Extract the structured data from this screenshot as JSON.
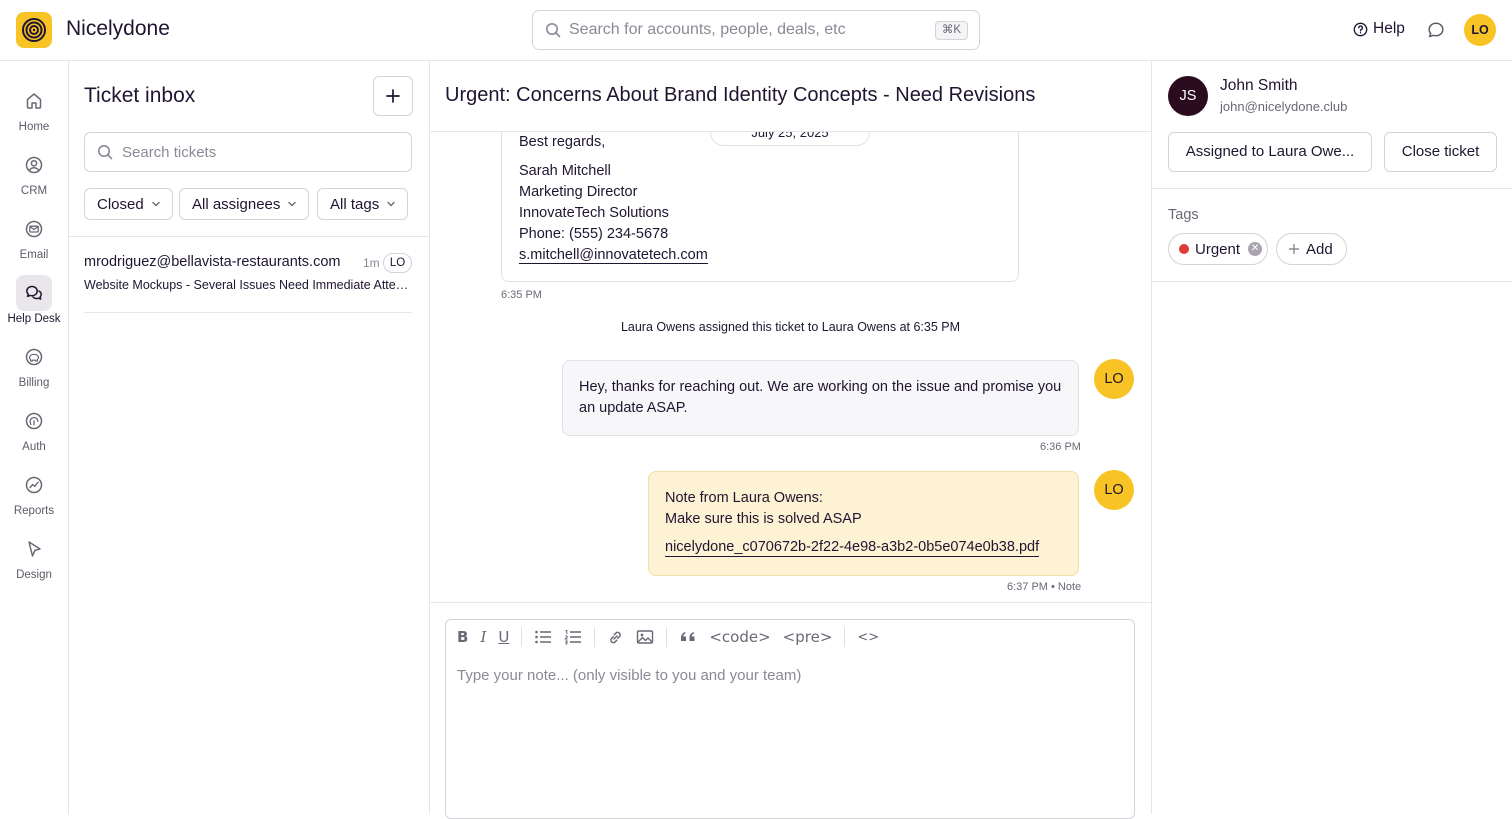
{
  "app": {
    "name": "Nicelydone"
  },
  "search": {
    "placeholder": "Search for accounts, people, deals, etc",
    "shortcut": "⌘K"
  },
  "header": {
    "help_label": "Help",
    "user_initials": "LO"
  },
  "nav": {
    "items": [
      {
        "label": "Home",
        "icon": "home-icon",
        "active": false
      },
      {
        "label": "CRM",
        "icon": "user-circle-icon",
        "active": false
      },
      {
        "label": "Email",
        "icon": "mail-icon",
        "active": false
      },
      {
        "label": "Help Desk",
        "icon": "chat-bubbles-icon",
        "active": true
      },
      {
        "label": "Billing",
        "icon": "piggy-bank-icon",
        "active": false
      },
      {
        "label": "Auth",
        "icon": "fingerprint-icon",
        "active": false
      },
      {
        "label": "Reports",
        "icon": "chart-icon",
        "active": false
      },
      {
        "label": "Design",
        "icon": "cursor-icon",
        "active": false
      }
    ]
  },
  "inbox": {
    "title": "Ticket inbox",
    "search_placeholder": "Search tickets",
    "filters": {
      "status": "Closed",
      "assignees": "All assignees",
      "tags": "All tags"
    },
    "tickets": [
      {
        "email": "mrodriguez@bellavista-restaurants.com",
        "time": "1m",
        "assignee": "LO",
        "subject": "Website Mockups - Several Issues Need Immediate Attention"
      }
    ]
  },
  "conversation": {
    "title": "Urgent: Concerns About Brand Identity Concepts - Need Revisions",
    "date": "July 25, 2025",
    "email_signature": {
      "closing": "Best regards,",
      "name": "Sarah Mitchell",
      "role": "Marketing Director",
      "company": "InnovateTech Solutions",
      "phone": "Phone: (555) 234-5678",
      "email": "s.mitchell@innovatetech.com"
    },
    "email_time": "6:35 PM",
    "system_message": "Laura Owens assigned this ticket to Laura Owens at 6:35 PM",
    "reply": {
      "text": "Hey, thanks for reaching out. We are working on the issue and promise you an update ASAP.",
      "time": "6:36 PM",
      "avatar": "LO"
    },
    "note": {
      "heading": "Note from Laura Owens:",
      "text": "Make sure this is solved ASAP",
      "attachment": "nicelydone_c070672b-2f22-4e98-a3b2-0b5e074e0b38.pdf",
      "time": "6:37 PM • Note",
      "avatar": "LO"
    }
  },
  "editor": {
    "placeholder": "Type your note... (only visible to you and your team)",
    "toolbar": {
      "bold": "B",
      "italic": "I",
      "underline": "U",
      "code": "<code>",
      "pre": "<pre>",
      "html": "<>"
    }
  },
  "customer": {
    "initials": "JS",
    "name": "John Smith",
    "email": "john@nicelydone.club",
    "assigned_label": "Assigned to Laura Owe...",
    "close_label": "Close ticket"
  },
  "tags": {
    "label": "Tags",
    "items": [
      {
        "name": "Urgent",
        "color": "#e03a3a"
      }
    ],
    "add_label": "Add"
  },
  "colors": {
    "accent": "#f7c325",
    "note_bg": "#fdf3d4",
    "customer_avatar": "#2b0c1f"
  }
}
